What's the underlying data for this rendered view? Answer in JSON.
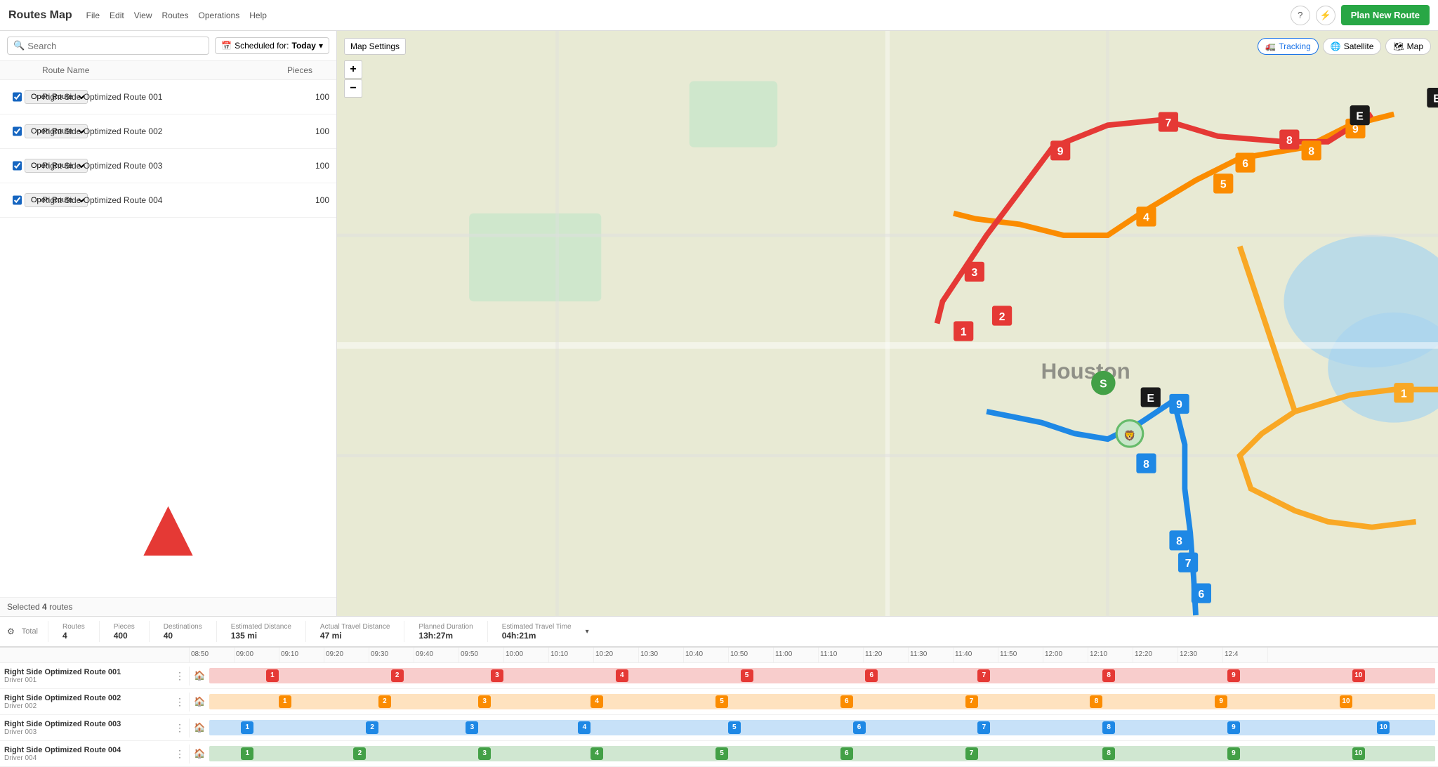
{
  "app": {
    "title": "Routes Map",
    "menu": [
      "File",
      "Edit",
      "View",
      "Routes",
      "Operations",
      "Help"
    ]
  },
  "toolbar": {
    "plan_route_label": "Plan New Route",
    "tracking_label": "Tracking",
    "satellite_label": "Satellite",
    "map_label": "Map"
  },
  "left_panel": {
    "search_placeholder": "Search",
    "schedule_label": "Scheduled for:",
    "schedule_value": "Today",
    "table_headers": [
      "",
      "Route Name",
      "Pieces"
    ],
    "routes": [
      {
        "id": 1,
        "name": "Right Side Optimized Route 001",
        "pieces": 100,
        "status": "Open Route",
        "color": "#e53935",
        "checked": true
      },
      {
        "id": 2,
        "name": "Right Side Optimized Route 002",
        "pieces": 100,
        "status": "Open Route",
        "color": "#fb8c00",
        "checked": true
      },
      {
        "id": 3,
        "name": "Right Side Optimized Route 003",
        "pieces": 100,
        "status": "Open Route",
        "color": "#1e88e5",
        "checked": true
      },
      {
        "id": 4,
        "name": "Right Side Optimized Route 004",
        "pieces": 100,
        "status": "Open Route",
        "color": "#43a047",
        "checked": true
      }
    ],
    "selected_count": "4",
    "selected_label": "Selected",
    "selected_suffix": "routes"
  },
  "map_settings": {
    "label": "Map Settings"
  },
  "bottom_stats": {
    "total_label": "Total",
    "routes_label": "Routes",
    "routes_value": "4",
    "pieces_label": "Pieces",
    "pieces_value": "400",
    "destinations_label": "Destinations",
    "destinations_value": "40",
    "est_distance_label": "Estimated Distance",
    "est_distance_value": "135 mi",
    "actual_distance_label": "Actual Travel Distance",
    "actual_distance_value": "47 mi",
    "planned_duration_label": "Planned Duration",
    "planned_duration_value": "13h:27m",
    "est_travel_label": "Estimated Travel Time",
    "est_travel_value": "04h:21m"
  },
  "timeline": {
    "ticks": [
      "08:50",
      "09:00",
      "09:10",
      "09:20",
      "09:30",
      "09:40",
      "09:50",
      "10:00",
      "10:10",
      "10:20",
      "10:30",
      "10:40",
      "10:50",
      "11:00",
      "11:10",
      "11:20",
      "11:30",
      "11:40",
      "11:50",
      "12:00",
      "12:10",
      "12:20",
      "12:30",
      "12:4"
    ],
    "rows": [
      {
        "name": "Right Side Optimized Route 001",
        "driver": "Driver 001",
        "color": "#e53935",
        "stops": [
          1,
          2,
          3,
          4,
          5,
          6,
          7,
          8,
          9,
          10
        ]
      },
      {
        "name": "Right Side Optimized Route 002",
        "driver": "Driver 002",
        "color": "#fb8c00",
        "stops": [
          1,
          2,
          3,
          4,
          5,
          6,
          7,
          8,
          9,
          10
        ]
      },
      {
        "name": "Right Side Optimized Route 003",
        "driver": "Driver 003",
        "color": "#1e88e5",
        "stops": [
          1,
          2,
          3,
          4,
          5,
          6,
          7,
          8,
          9,
          10
        ]
      },
      {
        "name": "Right Side Optimized Route 004",
        "driver": "Driver 004",
        "color": "#43a047",
        "stops": [
          1,
          2,
          3,
          4,
          5,
          6,
          7,
          8,
          9,
          10
        ]
      }
    ]
  }
}
